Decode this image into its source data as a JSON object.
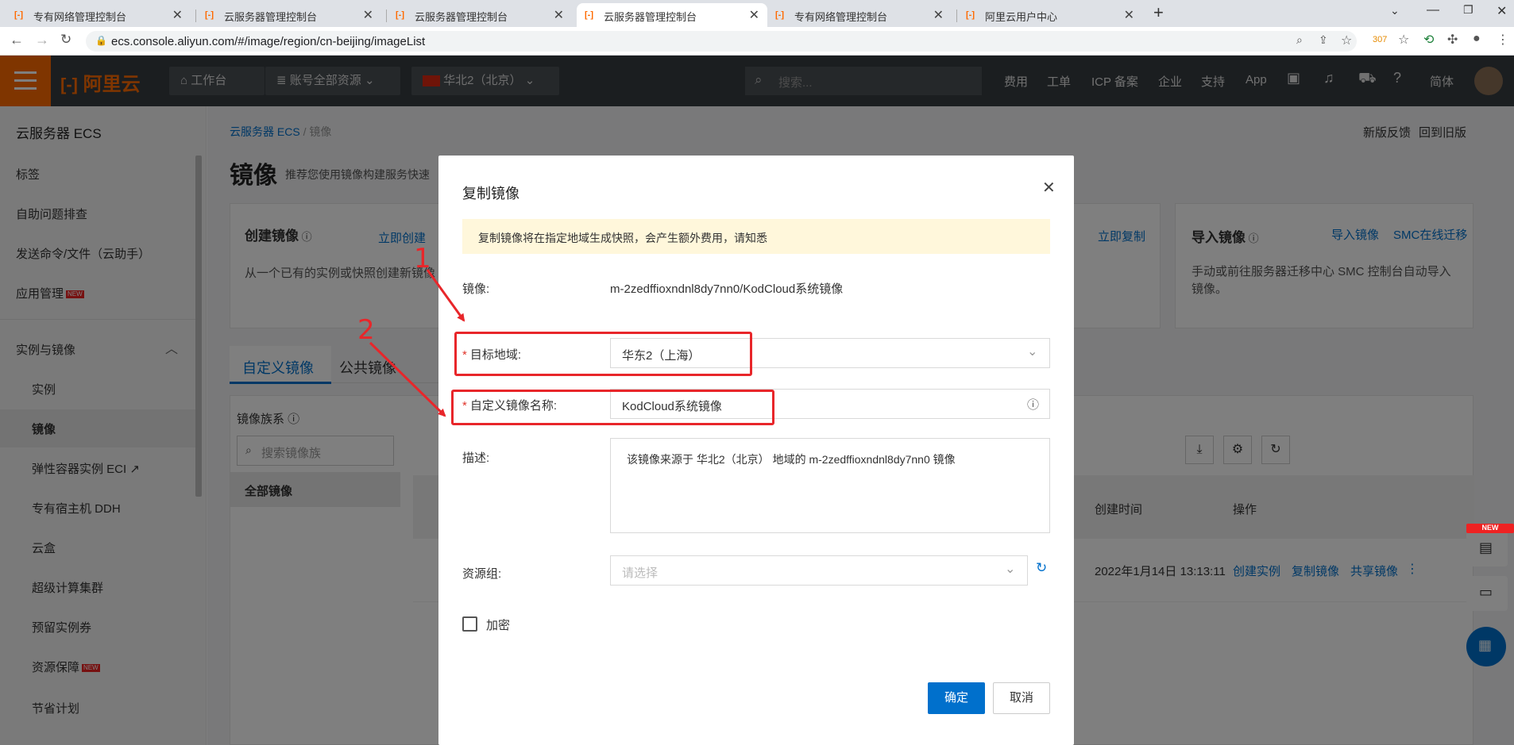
{
  "browser": {
    "tabs": [
      {
        "title": "专有网络管理控制台"
      },
      {
        "title": "云服务器管理控制台"
      },
      {
        "title": "云服务器管理控制台"
      },
      {
        "title": "云服务器管理控制台"
      },
      {
        "title": "专有网络管理控制台"
      },
      {
        "title": "阿里云用户中心"
      }
    ],
    "new_tab": "+",
    "url": "ecs.console.aliyun.com/#/image/region/cn-beijing/imageList",
    "ext_badge": "307"
  },
  "header": {
    "logo": "阿里云",
    "workbench": "工作台",
    "account_scope": "账号全部资源",
    "region": "华北2（北京）",
    "search_placeholder": "搜索...",
    "links": [
      "费用",
      "工单",
      "ICP 备案",
      "企业",
      "支持",
      "App"
    ],
    "lang": "简体"
  },
  "sidebar": {
    "title": "云服务器 ECS",
    "items": [
      "标签",
      "自助问题排查",
      "发送命令/文件（云助手）",
      "应用管理"
    ],
    "group": "实例与镜像",
    "sub_items": [
      "实例",
      "镜像",
      "弹性容器实例 ECI",
      "专有宿主机 DDH",
      "云盒",
      "超级计算集群",
      "预留实例券",
      "资源保障",
      "节省计划"
    ],
    "new_badge": "NEW"
  },
  "page": {
    "breadcrumb": [
      "云服务器 ECS",
      "镜像"
    ],
    "top_links": [
      "新版反馈",
      "回到旧版"
    ],
    "title": "镜像",
    "subtitle": "推荐您使用镜像构建服务快速",
    "create_card": {
      "title": "创建镜像",
      "link": "立即创建",
      "desc": "从一个已有的实例或快照创建新镜像"
    },
    "copy_link": "立即复制",
    "import_card": {
      "title": "导入镜像",
      "link1": "导入镜像",
      "link2": "SMC在线迁移",
      "desc1": "手动或前往服务器迁移中心 SMC 控制台自动导入",
      "desc2": "镜像。"
    },
    "tabs": [
      "自定义镜像",
      "公共镜像"
    ],
    "family_label": "镜像族系",
    "family_search_placeholder": "搜索镜像族",
    "family_all": "全部镜像",
    "columns": [
      "创建时间",
      "操作"
    ],
    "row": {
      "created": "2022年1月14日 13:13:11",
      "actions": [
        "创建实例",
        "复制镜像",
        "共享镜像"
      ]
    }
  },
  "modal": {
    "title": "复制镜像",
    "notice": "复制镜像将在指定地域生成快照，会产生额外费用，请知悉",
    "image_label": "镜像:",
    "image_value": "m-2zedffioxndnl8dy7nn0/KodCloud系统镜像",
    "region_label": "目标地域:",
    "region_value": "华东2（上海）",
    "name_label": "自定义镜像名称:",
    "name_value": "KodCloud系统镜像",
    "desc_label": "描述:",
    "desc_value": "该镜像来源于 华北2（北京） 地域的 m-2zedffioxndnl8dy7nn0 镜像",
    "rg_label": "资源组:",
    "rg_placeholder": "请选择",
    "encrypt_label": "加密",
    "ok": "确定",
    "cancel": "取消"
  },
  "annotations": [
    "1",
    "2"
  ],
  "colors": {
    "accent": "#0070cc",
    "brand": "#ff6a00",
    "annotation": "#e8262a"
  }
}
